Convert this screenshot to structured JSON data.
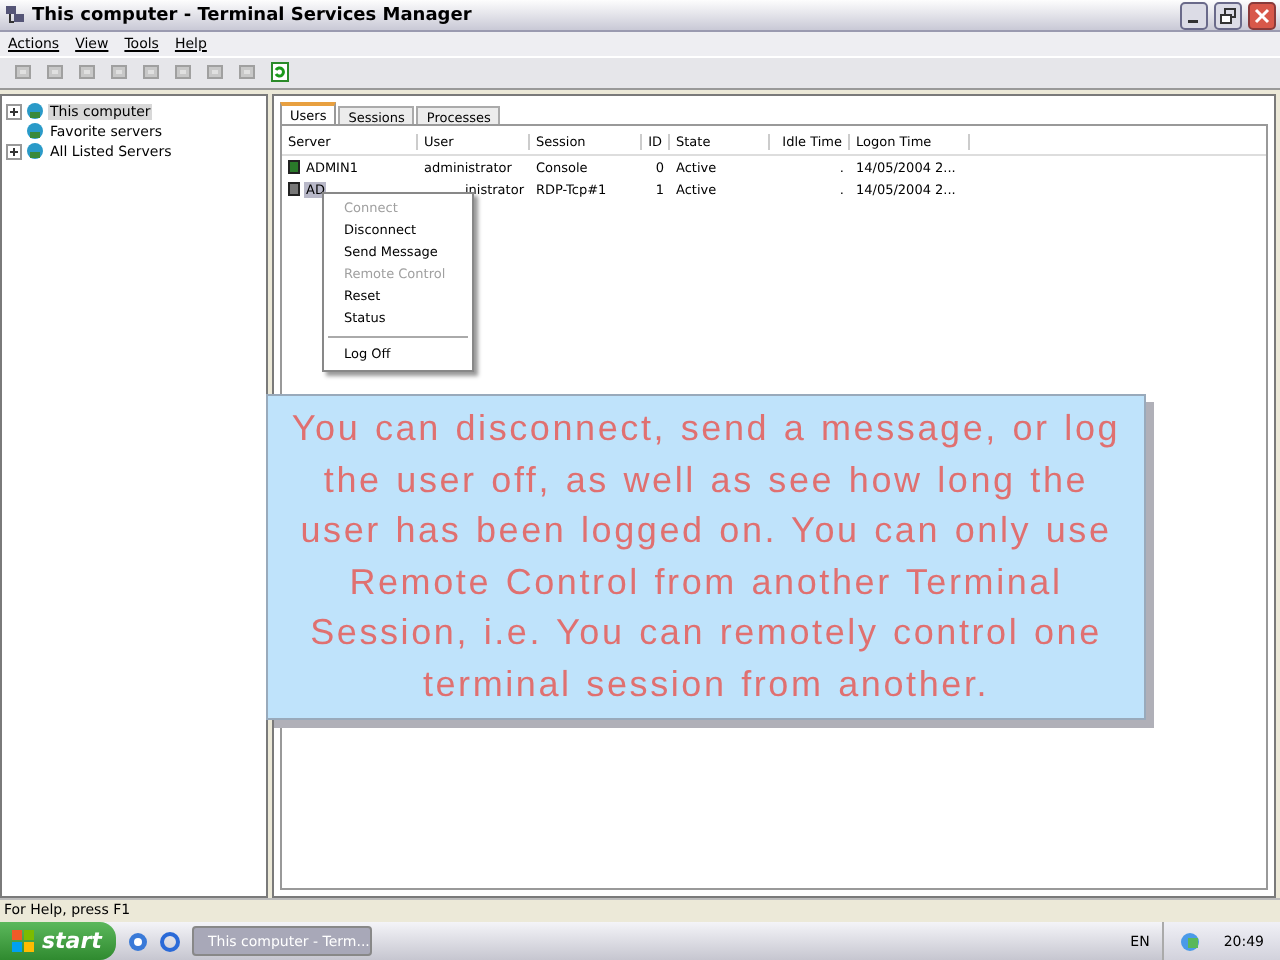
{
  "window": {
    "title": "This computer - Terminal Services Manager"
  },
  "menu": [
    "Actions",
    "View",
    "Tools",
    "Help"
  ],
  "toolbar": [
    {
      "disabled": true
    },
    {
      "disabled": true
    },
    {
      "disabled": true
    },
    {
      "disabled": true
    },
    {
      "disabled": true
    },
    {
      "disabled": true
    },
    {
      "disabled": true
    },
    {
      "disabled": true
    },
    {
      "disabled": false
    }
  ],
  "tree": [
    {
      "label": "This computer",
      "kind": "collapsed",
      "selected": true
    },
    {
      "label": "Favorite servers",
      "kind": "leaf",
      "selected": false
    },
    {
      "label": "All Listed Servers",
      "kind": "collapsed",
      "selected": false
    }
  ],
  "tabs": [
    {
      "label": "Users",
      "selected": true
    },
    {
      "label": "Sessions",
      "selected": false
    },
    {
      "label": "Processes",
      "selected": false
    }
  ],
  "table": {
    "columns": [
      "Server",
      "User",
      "Session",
      "ID",
      "State",
      "Idle Time",
      "Logon Time"
    ],
    "rows": [
      {
        "selected": false,
        "cells": [
          "ADMIN1",
          "administrator",
          "Console",
          "0",
          "Active",
          ".",
          "14/05/2004 2..."
        ]
      },
      {
        "selected": true,
        "cells": [
          "AD",
          "inistrator",
          "RDP-Tcp#1",
          "1",
          "Active",
          ".",
          "14/05/2004 2..."
        ]
      }
    ]
  },
  "context_menu": [
    {
      "label": "Connect",
      "disabled": true,
      "kind": "item"
    },
    {
      "label": "Disconnect",
      "disabled": false,
      "kind": "item"
    },
    {
      "label": "Send Message",
      "disabled": false,
      "kind": "item"
    },
    {
      "label": "Remote Control",
      "disabled": true,
      "kind": "item"
    },
    {
      "label": "Reset",
      "disabled": false,
      "kind": "item"
    },
    {
      "label": "Status",
      "disabled": false,
      "kind": "item"
    },
    {
      "kind": "separator"
    },
    {
      "label": "Log Off",
      "disabled": false,
      "kind": "item"
    }
  ],
  "caption": "You can disconnect, send a message, or log the user off, as well as see how long the user has been logged on. You can only use Remote Control from another Terminal Session, i.e. You can remotely control one terminal session from another.",
  "status_bar": "For Help, press F1",
  "taskbar": {
    "start": "start",
    "task": "This computer - Term...",
    "language": "EN",
    "clock": "20:49"
  }
}
